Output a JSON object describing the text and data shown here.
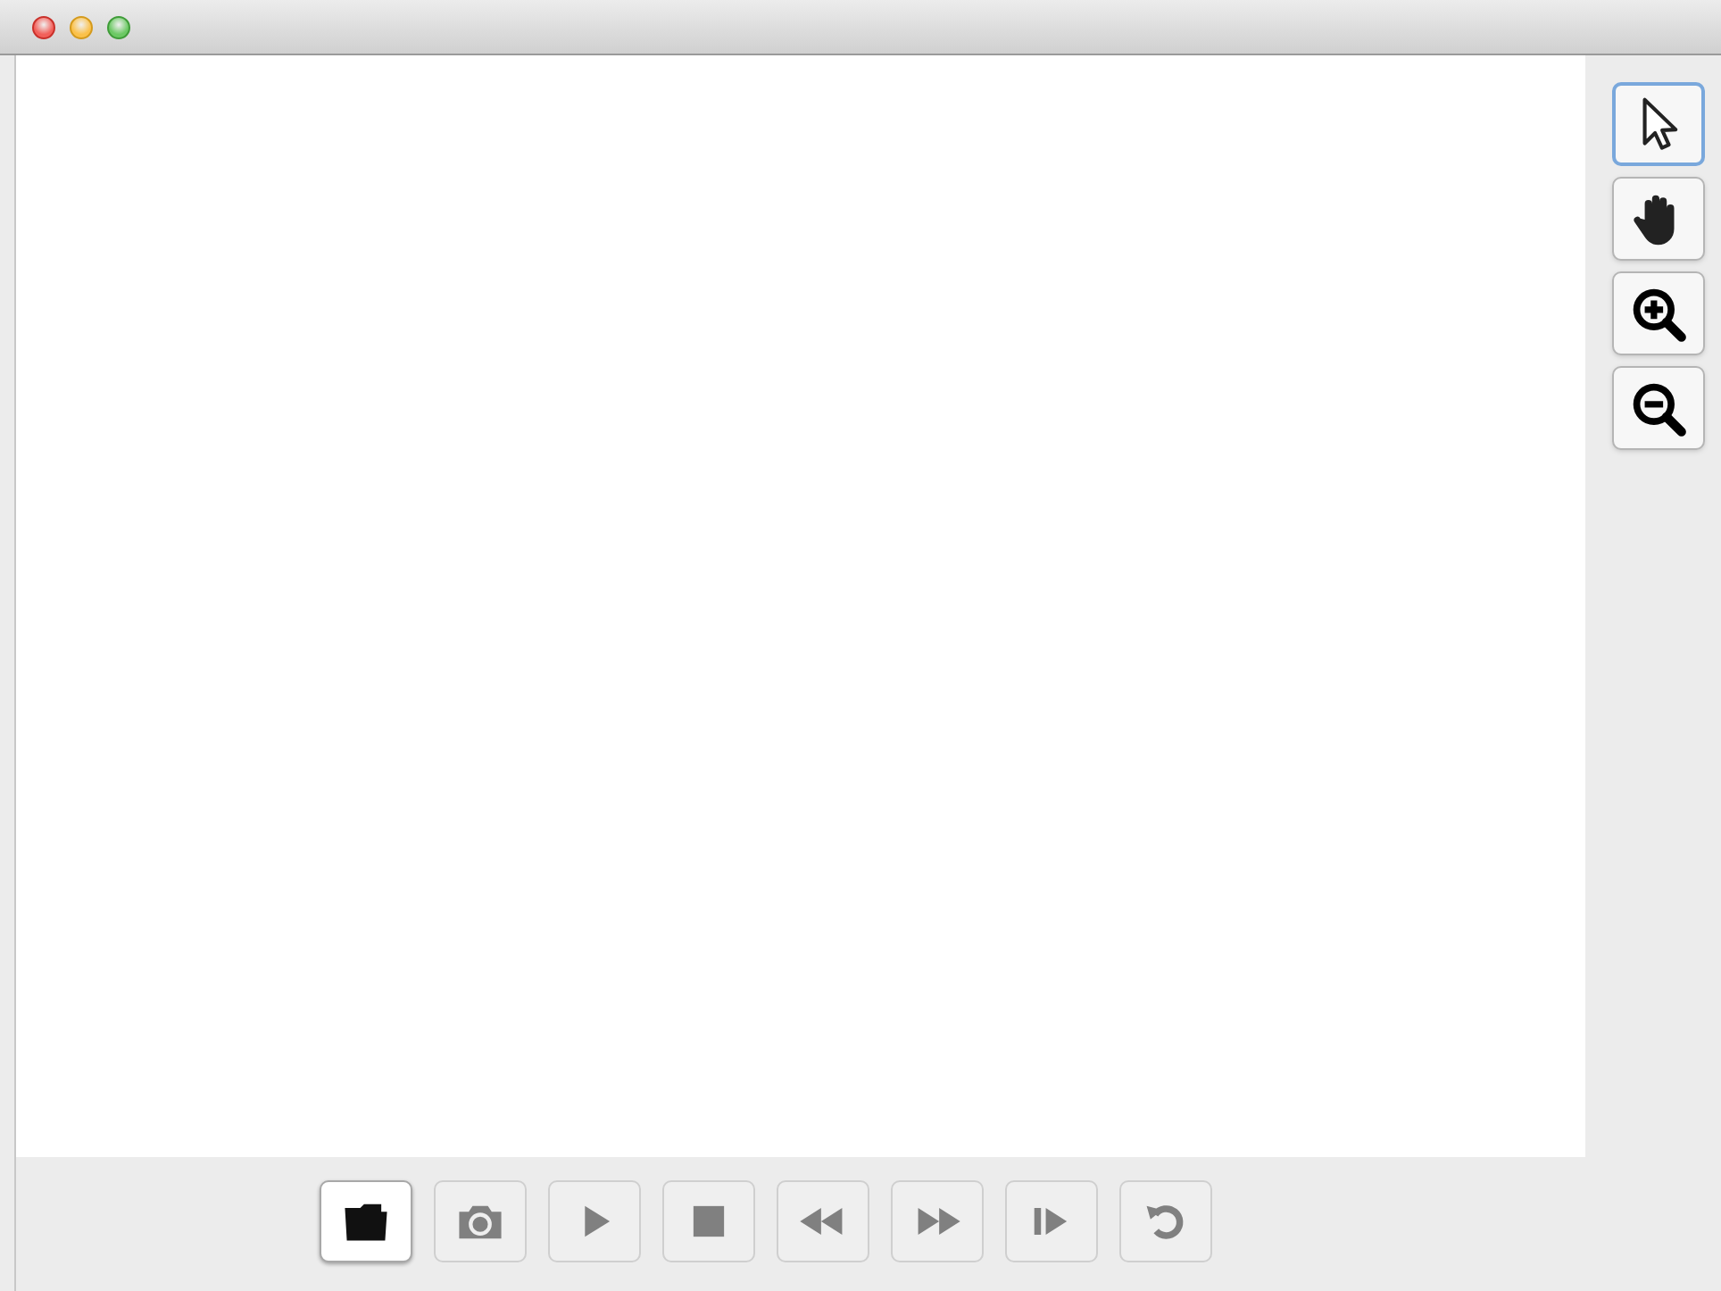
{
  "window": {
    "buttons": [
      {
        "kind": "close"
      },
      {
        "kind": "minimize"
      },
      {
        "kind": "zoom"
      }
    ]
  },
  "tools": [
    {
      "kind": "pointer",
      "selected": true
    },
    {
      "kind": "hand",
      "selected": false
    },
    {
      "kind": "zoom-in",
      "selected": false
    },
    {
      "kind": "zoom-out",
      "selected": false
    }
  ],
  "controls": [
    {
      "kind": "open",
      "disabled": false
    },
    {
      "kind": "camera",
      "disabled": true
    },
    {
      "kind": "play",
      "disabled": true
    },
    {
      "kind": "stop",
      "disabled": true
    },
    {
      "kind": "rewind",
      "disabled": true
    },
    {
      "kind": "fast-forward",
      "disabled": true
    },
    {
      "kind": "step",
      "disabled": true
    },
    {
      "kind": "reset",
      "disabled": true
    }
  ]
}
